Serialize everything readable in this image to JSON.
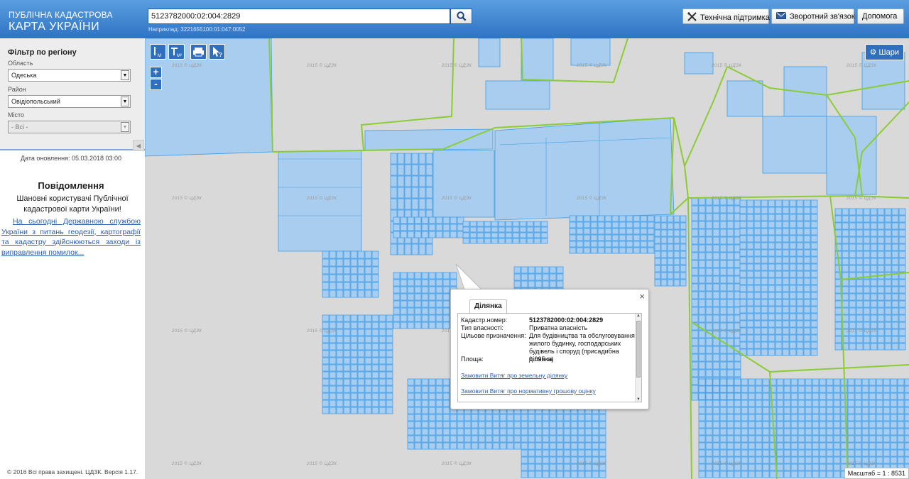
{
  "header": {
    "logo_line1": "ПУБЛІЧНА КАДАСТРОВА",
    "logo_line2": "КАРТА УКРАЇНИ",
    "search_value": "5123782000:02:004:2829",
    "search_example": "Наприклад: 3221655100:01:047:0052",
    "buttons": {
      "support": "Технічна підтримка",
      "feedback": "Зворотний зв'язок",
      "help": "Допомога"
    }
  },
  "sidebar": {
    "filter_title": "Фільтр по регіону",
    "region_label": "Область",
    "region_value": "Одеська",
    "district_label": "Район",
    "district_value": "Овідіопольський",
    "city_label": "Місто",
    "city_value": "- Всі -",
    "update_date": "Дата оновлення: 05.03.2018 03:00",
    "notice_title": "Повідомлення",
    "notice_text": "Шановні користувачі Публічної кадастрової карти України!",
    "notice_link": "На сьогодні Державною службою України з питань геодезії, картографії та кадастру здійснюються заходи із виправлення помилок...",
    "copyright": "© 2016 Всі права захищені. ЦДЗК. Версія 1.17."
  },
  "map": {
    "tools": {
      "measure_length": "M",
      "measure_area": "M²"
    },
    "layers_label": "Шари",
    "zoom_in": "+",
    "zoom_out": "-",
    "scale": "Масштаб = 1 : 8531",
    "watermark": "2015 © ЦДЗК"
  },
  "popup": {
    "tab": "Ділянка",
    "rows": [
      {
        "key": "Кадастр.номер:",
        "value": "5123782000:02:004:2829"
      },
      {
        "key": "Тип власності:",
        "value": "Приватна власність"
      },
      {
        "key": "Цільове призначення:",
        "value": "Для будівництва та обслуговування жилого будинку, господарських будівель і споруд (присадибна ділянка)"
      },
      {
        "key": "Площа:",
        "value": "0.095 га"
      }
    ],
    "link1": "Замовити Витяг про земельну ділянку",
    "link2": "Замовити Витяг про нормативну грошову оцінку",
    "close": "×"
  },
  "colors": {
    "header_top": "#5a9ee0",
    "header_bottom": "#2f73c4",
    "parcel_fill": "#a9cdee",
    "parcel_stroke": "#3c9de8",
    "boundary_green": "#8ccc33",
    "map_bg": "#d9d9d9"
  }
}
